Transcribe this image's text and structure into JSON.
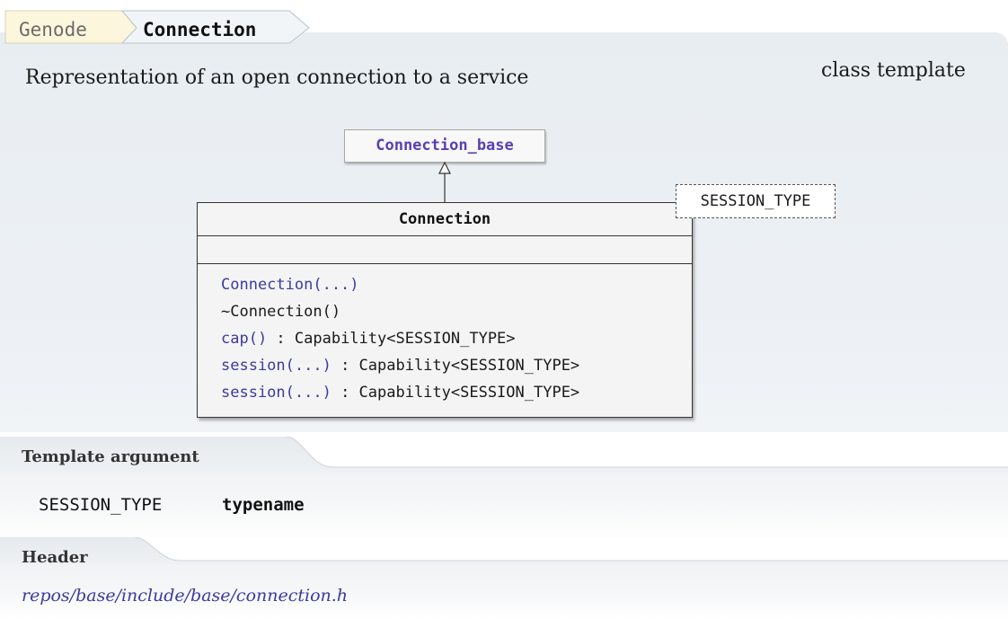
{
  "breadcrumb": {
    "parent": "Genode",
    "current": "Connection"
  },
  "description": "Representation of an open connection to a service",
  "kind": "class template",
  "diagram": {
    "base_class": "Connection_base",
    "class_name": "Connection",
    "template_param": "SESSION_TYPE",
    "methods": [
      {
        "name": "Connection(...)",
        "type": "",
        "linked": true
      },
      {
        "name": "~Connection()",
        "type": "",
        "linked": false
      },
      {
        "name": "cap()",
        "type": " : Capability<SESSION_TYPE>",
        "linked": true
      },
      {
        "name": "session(...)",
        "type": " : Capability<SESSION_TYPE>",
        "linked": true
      },
      {
        "name": "session(...)",
        "type": " : Capability<SESSION_TYPE>",
        "linked": true
      }
    ]
  },
  "template_argument": {
    "heading": "Template argument",
    "name": "SESSION_TYPE",
    "type": "typename"
  },
  "header": {
    "heading": "Header",
    "path": "repos/base/include/base/connection.h"
  },
  "colors": {
    "link": "#3b3ba0",
    "base_class": "#5b3fb0",
    "panel": "#e8edf2"
  }
}
